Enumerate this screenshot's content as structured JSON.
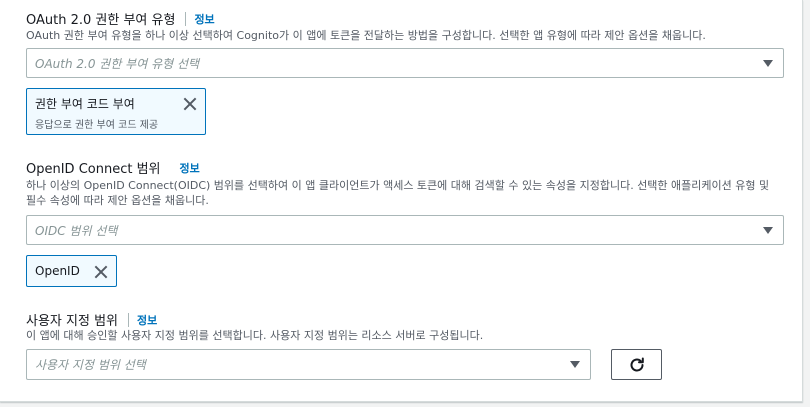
{
  "oauth": {
    "label": "OAuth 2.0 권한 부여 유형",
    "info": "정보",
    "description": "OAuth 권한 부여 유형을 하나 이상 선택하여 Cognito가 이 앱에 토큰을 전달하는 방법을 구성합니다. 선택한 앱 유형에 따라 제안 옵션을 채웁니다.",
    "placeholder": "OAuth 2.0 권한 부여 유형 선택",
    "token": {
      "title": "권한 부여 코드 부여",
      "subtitle": "응답으로 권한 부여 코드 제공"
    }
  },
  "oidc": {
    "label": "OpenID Connect 범위",
    "info": "정보",
    "description_line1": "하나 이상의 OpenID Connect(OIDC) 범위를 선택하여 이 앱 클라이언트가 액세스 토큰에 대해 검색할 수 있는 속성을 지정합니다. 선택한 애플리케이션 유형 및",
    "description_line2": "필수 속성에 따라 제안 옵션을 채웁니다.",
    "placeholder": "OIDC 범위 선택",
    "token": "OpenID"
  },
  "custom": {
    "label": "사용자 지정 범위",
    "info": "정보",
    "description": "이 앱에 대해 승인할 사용자 지정 범위를 선택합니다. 사용자 지정 범위는 리소스 서버로 구성됩니다.",
    "placeholder": "사용자 지정 범위 선택"
  },
  "icons": {
    "caret": "caret-down-icon",
    "dismiss": "close-icon",
    "refresh": "refresh-icon"
  }
}
